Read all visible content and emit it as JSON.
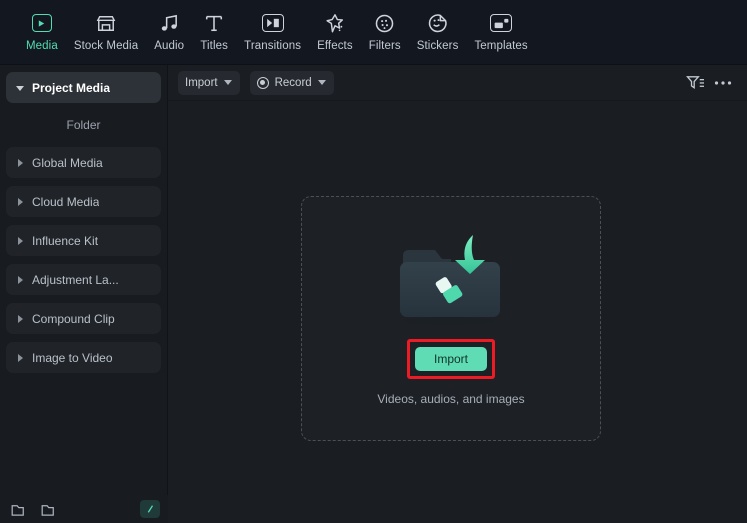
{
  "colors": {
    "accent": "#52dcb0",
    "import_button_bg": "#5fdcb4",
    "highlight_border": "#ed1c24",
    "topbar_bg": "#131820",
    "sidebar_bg": "#181b20",
    "content_bg": "#1a1d21"
  },
  "toolbar": {
    "items": [
      {
        "label": "Media",
        "icon": "media-icon",
        "active": true
      },
      {
        "label": "Stock Media",
        "icon": "stock-media-icon",
        "active": false
      },
      {
        "label": "Audio",
        "icon": "audio-icon",
        "active": false
      },
      {
        "label": "Titles",
        "icon": "titles-icon",
        "active": false
      },
      {
        "label": "Transitions",
        "icon": "transitions-icon",
        "active": false
      },
      {
        "label": "Effects",
        "icon": "effects-icon",
        "active": false
      },
      {
        "label": "Filters",
        "icon": "filters-icon",
        "active": false
      },
      {
        "label": "Stickers",
        "icon": "stickers-icon",
        "active": false
      },
      {
        "label": "Templates",
        "icon": "templates-icon",
        "active": false
      }
    ]
  },
  "sidebar": {
    "selected": "Project Media",
    "items": [
      {
        "label": "Project Media",
        "selected": true,
        "expanded": true
      },
      {
        "label": "Global Media",
        "selected": false,
        "expanded": false
      },
      {
        "label": "Cloud Media",
        "selected": false,
        "expanded": false
      },
      {
        "label": "Influence Kit",
        "selected": false,
        "expanded": false
      },
      {
        "label": "Adjustment La...",
        "selected": false,
        "expanded": false
      },
      {
        "label": "Compound Clip",
        "selected": false,
        "expanded": false
      },
      {
        "label": "Image to Video",
        "selected": false,
        "expanded": false
      }
    ],
    "folder_header": "Folder",
    "bottom": {
      "new_folder_icon": "new-folder-icon",
      "open_folder_icon": "open-folder-icon",
      "collapse_icon": "collapse-panel-icon"
    }
  },
  "content_toolbar": {
    "import": {
      "label": "Import",
      "chevron": "chevron-down-icon"
    },
    "record": {
      "label": "Record",
      "icon": "record-dot-icon",
      "chevron": "chevron-down-icon"
    },
    "filter_icon": "filter-sort-icon",
    "more_icon": "more-options-icon"
  },
  "dropzone": {
    "illustration": "folder-with-down-arrow-icon",
    "import_button": "Import",
    "hint": "Videos, audios, and images"
  }
}
